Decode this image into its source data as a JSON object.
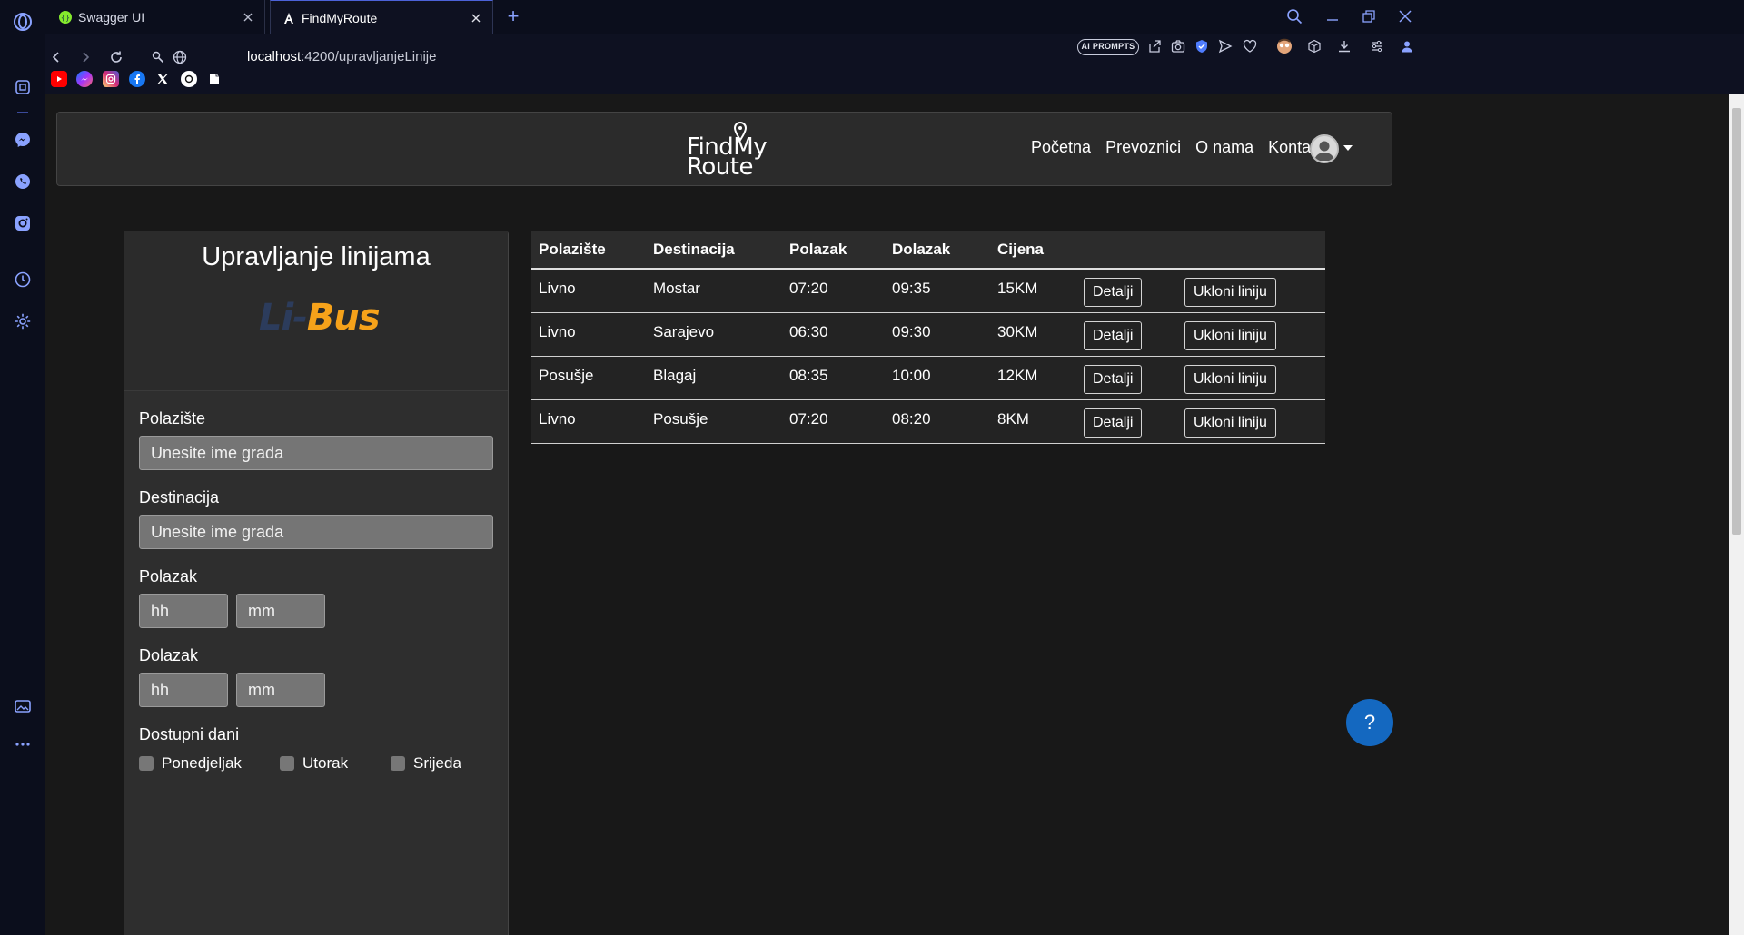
{
  "browser": {
    "tabs": [
      {
        "title": "Swagger UI",
        "icon": "swagger-icon"
      },
      {
        "title": "FindMyRoute",
        "icon": "angular-icon"
      }
    ],
    "url_host": "localhost",
    "url_path": ":4200/upravljanjeLinije",
    "ai_prompts_label": "AI PROMPTS",
    "bookmarks": [
      "youtube-icon",
      "messenger-icon",
      "instagram-icon",
      "facebook-icon",
      "x-icon",
      "chatgpt-icon",
      "document-icon"
    ],
    "sidebar_icons": [
      "opera-logo-icon",
      "aria-icon",
      "messenger-icon",
      "whatsapp-icon",
      "instagram-icon",
      "history-icon",
      "settings-icon",
      "gallery-icon",
      "more-icon"
    ]
  },
  "site": {
    "logo_line1": "FindMy",
    "logo_line2": "Route",
    "nav": [
      "Početna",
      "Prevoznici",
      "O nama",
      "Kontakt"
    ]
  },
  "form": {
    "title": "Upravljanje linijama",
    "brand_li": "Li-",
    "brand_bus": "Bus",
    "polaziste_label": "Polazište",
    "polaziste_placeholder": "Unesite ime grada",
    "destinacija_label": "Destinacija",
    "destinacija_placeholder": "Unesite ime grada",
    "polazak_label": "Polazak",
    "dolazak_label": "Dolazak",
    "hh_placeholder": "hh",
    "mm_placeholder": "mm",
    "dani_label": "Dostupni dani",
    "days": [
      "Ponedjeljak",
      "Utorak",
      "Srijeda"
    ]
  },
  "table": {
    "headers": [
      "Polazište",
      "Destinacija",
      "Polazak",
      "Dolazak",
      "Cijena"
    ],
    "details_label": "Detalji",
    "remove_label": "Ukloni liniju",
    "rows": [
      [
        "Livno",
        "Mostar",
        "07:20",
        "09:35",
        "15KM"
      ],
      [
        "Livno",
        "Sarajevo",
        "06:30",
        "09:30",
        "30KM"
      ],
      [
        "Posušje",
        "Blagaj",
        "08:35",
        "10:00",
        "12KM"
      ],
      [
        "Livno",
        "Posušje",
        "07:20",
        "08:20",
        "8KM"
      ]
    ]
  },
  "help_label": "?",
  "colors": {
    "accent": "#1468c0",
    "brand_orange": "#f6a21a"
  }
}
